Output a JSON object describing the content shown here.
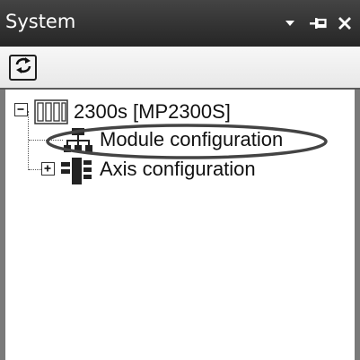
{
  "panel": {
    "title": "System",
    "title_buttons": {
      "dropdown_icon": "dropdown-arrow-icon",
      "pin_icon": "pin-icon",
      "close_icon": "close-icon"
    }
  },
  "toolbar": {
    "refresh_icon": "refresh-icon"
  },
  "tree": {
    "root": {
      "label": "2300s [MP2300S]",
      "expanded": true,
      "icon": "controller-rack-icon"
    },
    "children": [
      {
        "label": "Module configuration",
        "icon": "module-network-icon",
        "expandable": false,
        "highlighted": true
      },
      {
        "label": "Axis configuration",
        "icon": "axis-blocks-icon",
        "expandable": true,
        "expanded": false
      }
    ]
  },
  "colors": {
    "titlebar": "#333333",
    "title_text": "#ffffff",
    "highlight_ellipse": "#444444"
  }
}
